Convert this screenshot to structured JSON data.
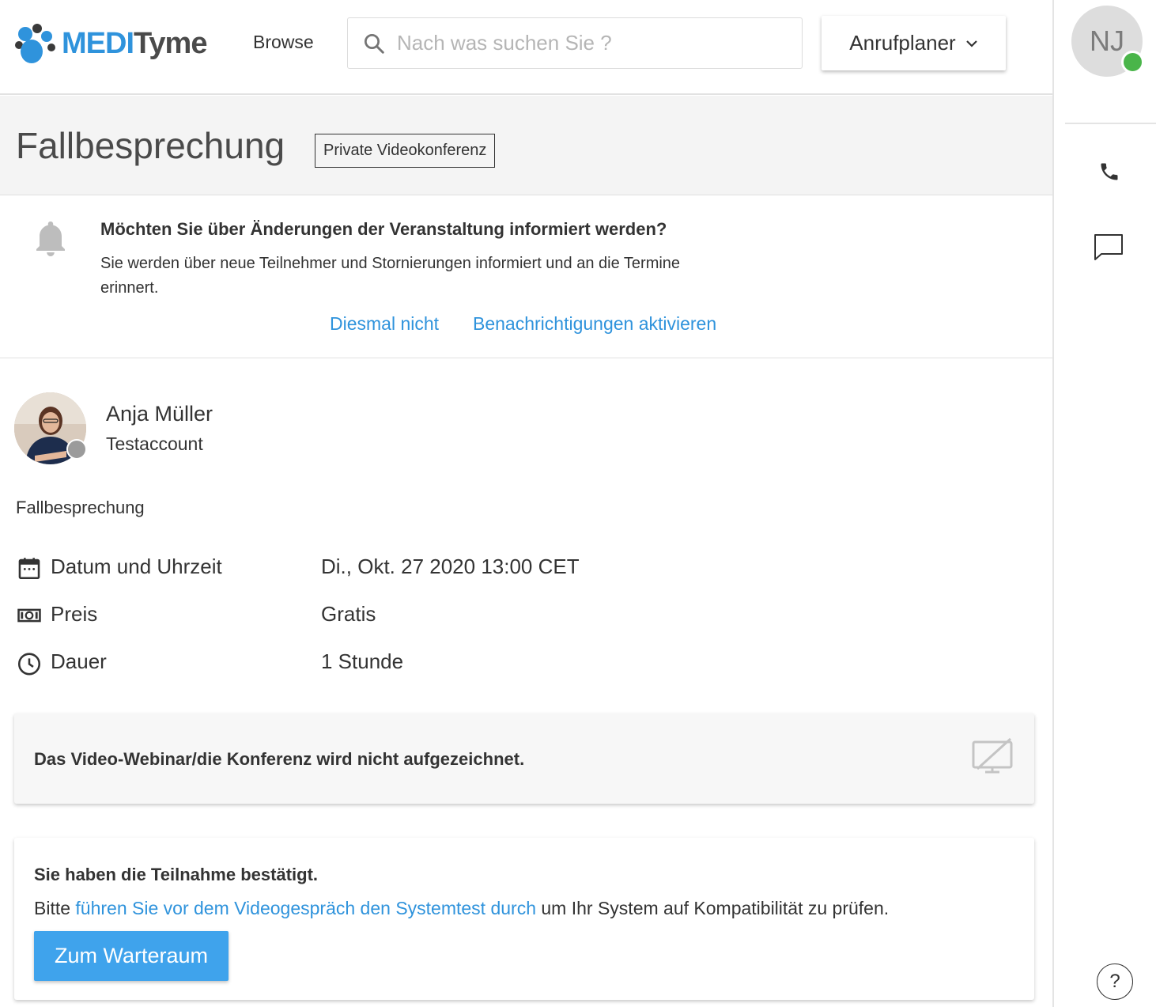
{
  "header": {
    "logo_text_brand": "MEDI",
    "logo_text_rest": "Tyme",
    "browse_label": "Browse",
    "search_placeholder": "Nach was suchen Sie ?",
    "planner_label": "Anrufplaner"
  },
  "event": {
    "title": "Fallbesprechung",
    "type_badge": "Private Videokonferenz",
    "description": "Fallbesprechung"
  },
  "notification": {
    "title": "Möchten Sie über Änderungen der Veranstaltung informiert werden?",
    "text": "Sie werden über neue Teilnehmer und Stornierungen informiert und an die Termine erinnert.",
    "dismiss_label": "Diesmal nicht",
    "activate_label": "Benachrichtigungen aktivieren"
  },
  "host": {
    "name": "Anja Müller",
    "role": "Testaccount"
  },
  "details": [
    {
      "icon": "calendar-icon",
      "label": "Datum und Uhrzeit",
      "value": "Di., Okt. 27 2020 13:00 CET"
    },
    {
      "icon": "money-icon",
      "label": "Preis",
      "value": "Gratis"
    },
    {
      "icon": "clock-icon",
      "label": "Dauer",
      "value": "1 Stunde"
    }
  ],
  "recording": {
    "text": "Das Video-Webinar/die Konferenz wird nicht aufgezeichnet."
  },
  "confirmation": {
    "title": "Sie haben die Teilnahme bestätigt.",
    "text_before": "Bitte ",
    "link_text": "führen Sie vor dem Videogespräch den Systemtest durch",
    "text_after": " um Ihr System auf Kompatibilität zu prüfen.",
    "button_label": "Zum Warteraum"
  },
  "sidebar": {
    "user_initials": "NJ",
    "help_label": "?"
  },
  "colors": {
    "accent": "#2f93dc",
    "button": "#3fa3ec",
    "online": "#4ab54a",
    "offline": "#9b9b9b"
  }
}
